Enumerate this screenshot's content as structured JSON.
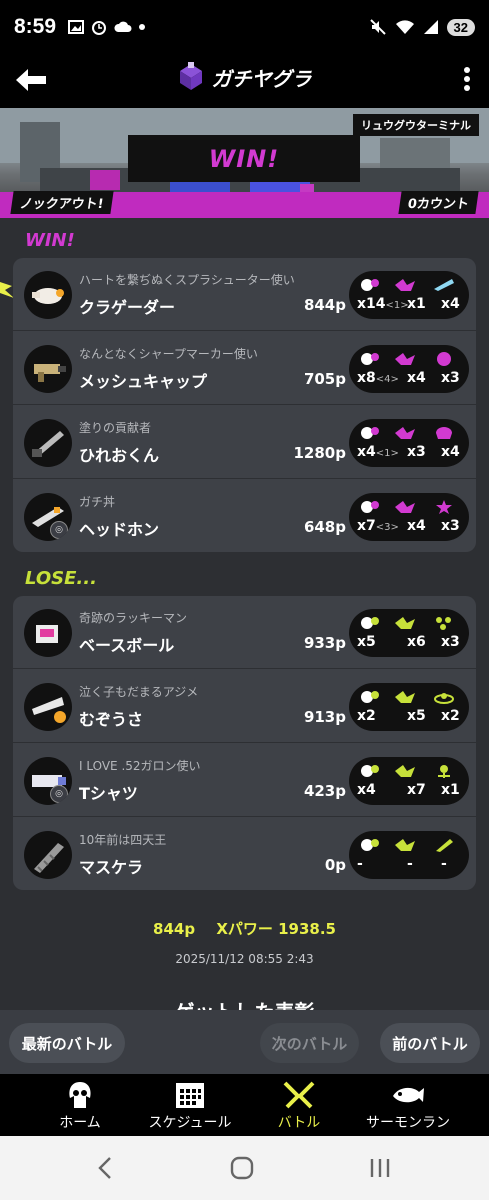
{
  "status_bar": {
    "time": "8:59",
    "battery": "32"
  },
  "header": {
    "title": "ガチヤグラ"
  },
  "banner": {
    "stage": "リュウグウターミナル",
    "result": "WIN!",
    "finish": "ノックアウト!",
    "count": "0カウント"
  },
  "winning_team": {
    "label": "WIN!",
    "players": [
      {
        "title": "ハートを繋ぢぬくスプラシューター使い",
        "name": "クラゲーダー",
        "points": "844p",
        "kills": "x14",
        "kills_assist": "<1>",
        "specials_used": "x1",
        "special_count": "x4"
      },
      {
        "title": "なんとなくシャープマーカー使い",
        "name": "メッシュキャップ",
        "points": "705p",
        "kills": "x8",
        "kills_assist": "<4>",
        "specials_used": "x4",
        "special_count": "x3"
      },
      {
        "title": "塗りの貢献者",
        "name": "ひれおくん",
        "points": "1280p",
        "kills": "x4",
        "kills_assist": "<1>",
        "specials_used": "x3",
        "special_count": "x4"
      },
      {
        "title": "ガチ丼",
        "name": "ヘッドホン",
        "points": "648p",
        "kills": "x7",
        "kills_assist": "<3>",
        "specials_used": "x4",
        "special_count": "x3"
      }
    ]
  },
  "losing_team": {
    "label": "LOSE...",
    "players": [
      {
        "title": "奇跡のラッキーマン",
        "name": "ベースボール",
        "points": "933p",
        "kills": "x5",
        "kills_assist": "",
        "specials_used": "x6",
        "special_count": "x3"
      },
      {
        "title": "泣く子もだまるアジメ",
        "name": "むぞうさ",
        "points": "913p",
        "kills": "x2",
        "kills_assist": "",
        "specials_used": "x5",
        "special_count": "x2"
      },
      {
        "title": "I LOVE .52ガロン使い",
        "name": "Tシャツ",
        "points": "423p",
        "kills": "x4",
        "kills_assist": "",
        "specials_used": "x7",
        "special_count": "x1"
      },
      {
        "title": "10年前は四天王",
        "name": "マスケラ",
        "points": "0p",
        "kills": "-",
        "kills_assist": "",
        "specials_used": "-",
        "special_count": "-"
      }
    ]
  },
  "summary": {
    "points": "844p",
    "xpower": "Xパワー 1938.5",
    "datetime": "2025/11/12 08:55 2:43",
    "next_heading": "ゲットした表彰"
  },
  "buttons": {
    "latest": "最新のバトル",
    "next": "次のバトル",
    "prev": "前のバトル"
  },
  "tabs": [
    {
      "label": "ホーム",
      "icon": "squid-home-icon"
    },
    {
      "label": "スケジュール",
      "icon": "calendar-icon"
    },
    {
      "label": "バトル",
      "icon": "battle-icon"
    },
    {
      "label": "サーモンラン",
      "icon": "salmon-icon"
    }
  ],
  "colors": {
    "win": "#d23ad1",
    "lose": "#c7e13a",
    "accent": "#e9f04a"
  }
}
